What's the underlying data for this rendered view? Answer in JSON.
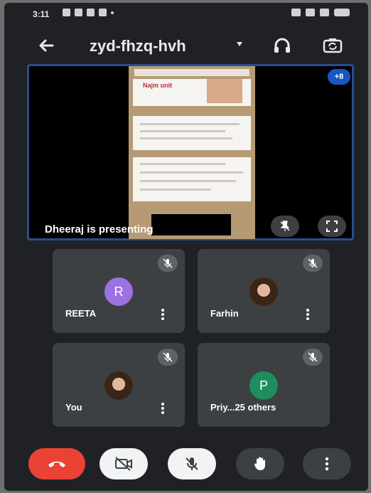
{
  "status_bar": {
    "time": "3:11"
  },
  "meeting": {
    "code": "zyd-fhzq-hvh"
  },
  "presentation": {
    "label": "Dheeraj is presenting",
    "doc_heading": "Najm unit",
    "participants_badge": "+8"
  },
  "tiles": [
    {
      "name": "REETA",
      "initial": "R",
      "avatar_color": "#9b72e0"
    },
    {
      "name": "Farhin",
      "initial": ""
    },
    {
      "name": "You",
      "initial": ""
    },
    {
      "name": "Priy...25 others",
      "initial": "P",
      "avatar_color": "#1e8e5e"
    }
  ],
  "colors": {
    "background": "#202124",
    "tile": "#3c4043",
    "end_call": "#ea4335",
    "presentation_border": "#2a4d8f"
  },
  "icons": [
    "back-arrow-icon",
    "headphones-icon",
    "switch-camera-icon",
    "pin-icon",
    "fullscreen-icon",
    "mic-off-icon",
    "end-call-icon",
    "camera-off-icon",
    "raise-hand-icon",
    "more-vert-icon"
  ]
}
